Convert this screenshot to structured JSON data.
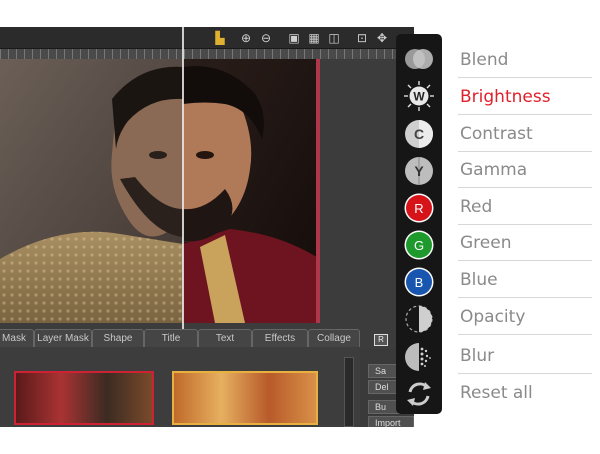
{
  "editor": {
    "tabs": [
      "Mask",
      "Layer Mask",
      "Shape",
      "Title",
      "Text",
      "Effects",
      "Collage"
    ],
    "side_buttons": [
      "Sa",
      "Del",
      "Bu",
      "Import"
    ],
    "badge": "R"
  },
  "adjustments": {
    "accent": "#e0202a",
    "items": [
      {
        "label": "Blend",
        "icon": "blend-icon",
        "glyph": ""
      },
      {
        "label": "Brightness",
        "icon": "brightness-icon",
        "glyph": "W",
        "active": true
      },
      {
        "label": "Contrast",
        "icon": "contrast-icon",
        "glyph": "C"
      },
      {
        "label": "Gamma",
        "icon": "gamma-icon",
        "glyph": "Y"
      },
      {
        "label": "Red",
        "icon": "red-channel-icon",
        "glyph": "R",
        "color": "#d7131a"
      },
      {
        "label": "Green",
        "icon": "green-channel-icon",
        "glyph": "G",
        "color": "#1e9a2c"
      },
      {
        "label": "Blue",
        "icon": "blue-channel-icon",
        "glyph": "B",
        "color": "#1956b0"
      },
      {
        "label": "Opacity",
        "icon": "opacity-icon",
        "glyph": ""
      },
      {
        "label": "Blur",
        "icon": "blur-icon",
        "glyph": ""
      },
      {
        "label": "Reset all",
        "icon": "reset-icon",
        "glyph": ""
      }
    ]
  }
}
